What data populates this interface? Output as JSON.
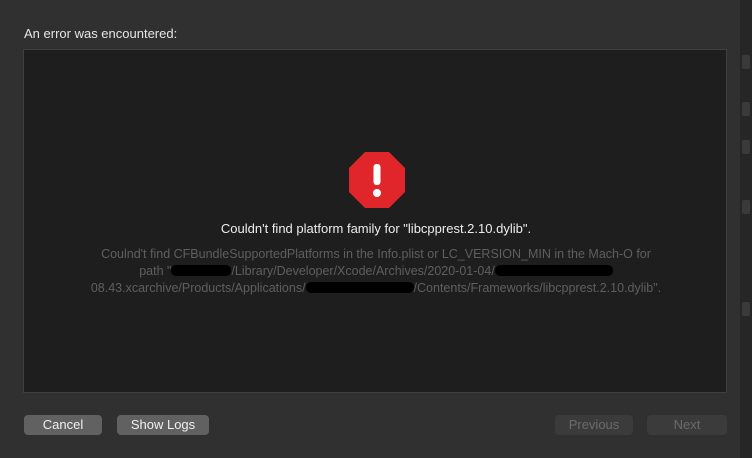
{
  "dialog": {
    "header": "An error was encountered:",
    "headline": "Couldn't find platform family for \"libcpprest.2.10.dylib\".",
    "detail": {
      "line1": "Coulnd't find CFBundleSupportedPlatforms in the Info.plist or LC_VERSION_MIN in the Mach-O for",
      "line2_a": "path \"",
      "line2_b": "/Library/Developer/Xcode/Archives/2020-01-04/",
      "line2_c": "",
      "line3_a": "08.43.xcarchive/Products/Applications/",
      "line3_b": "/Contents/Frameworks/libcpprest.2.10.dylib\"."
    },
    "icon": "error-stop-icon",
    "colors": {
      "error_red": "#e0262b"
    }
  },
  "buttons": {
    "cancel": "Cancel",
    "show_logs": "Show Logs",
    "previous": "Previous",
    "next": "Next"
  }
}
